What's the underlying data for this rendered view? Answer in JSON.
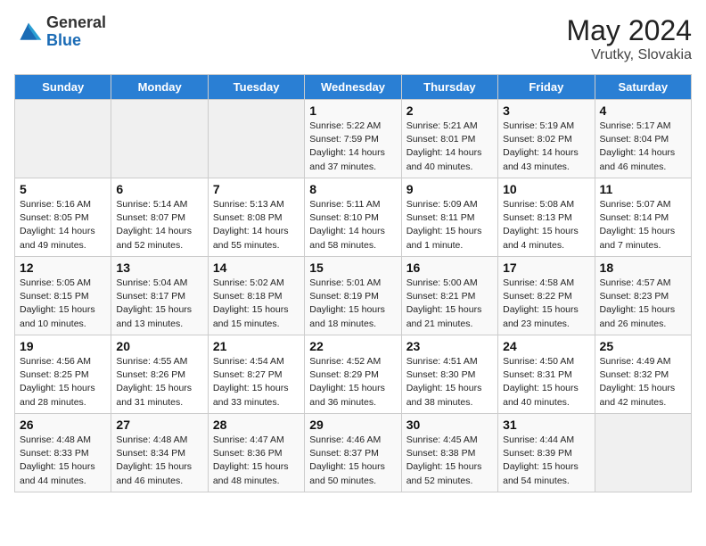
{
  "header": {
    "logo_general": "General",
    "logo_blue": "Blue",
    "month_year": "May 2024",
    "location": "Vrutky, Slovakia"
  },
  "weekdays": [
    "Sunday",
    "Monday",
    "Tuesday",
    "Wednesday",
    "Thursday",
    "Friday",
    "Saturday"
  ],
  "weeks": [
    [
      {
        "day": "",
        "info": ""
      },
      {
        "day": "",
        "info": ""
      },
      {
        "day": "",
        "info": ""
      },
      {
        "day": "1",
        "info": "Sunrise: 5:22 AM\nSunset: 7:59 PM\nDaylight: 14 hours and 37 minutes."
      },
      {
        "day": "2",
        "info": "Sunrise: 5:21 AM\nSunset: 8:01 PM\nDaylight: 14 hours and 40 minutes."
      },
      {
        "day": "3",
        "info": "Sunrise: 5:19 AM\nSunset: 8:02 PM\nDaylight: 14 hours and 43 minutes."
      },
      {
        "day": "4",
        "info": "Sunrise: 5:17 AM\nSunset: 8:04 PM\nDaylight: 14 hours and 46 minutes."
      }
    ],
    [
      {
        "day": "5",
        "info": "Sunrise: 5:16 AM\nSunset: 8:05 PM\nDaylight: 14 hours and 49 minutes."
      },
      {
        "day": "6",
        "info": "Sunrise: 5:14 AM\nSunset: 8:07 PM\nDaylight: 14 hours and 52 minutes."
      },
      {
        "day": "7",
        "info": "Sunrise: 5:13 AM\nSunset: 8:08 PM\nDaylight: 14 hours and 55 minutes."
      },
      {
        "day": "8",
        "info": "Sunrise: 5:11 AM\nSunset: 8:10 PM\nDaylight: 14 hours and 58 minutes."
      },
      {
        "day": "9",
        "info": "Sunrise: 5:09 AM\nSunset: 8:11 PM\nDaylight: 15 hours and 1 minute."
      },
      {
        "day": "10",
        "info": "Sunrise: 5:08 AM\nSunset: 8:13 PM\nDaylight: 15 hours and 4 minutes."
      },
      {
        "day": "11",
        "info": "Sunrise: 5:07 AM\nSunset: 8:14 PM\nDaylight: 15 hours and 7 minutes."
      }
    ],
    [
      {
        "day": "12",
        "info": "Sunrise: 5:05 AM\nSunset: 8:15 PM\nDaylight: 15 hours and 10 minutes."
      },
      {
        "day": "13",
        "info": "Sunrise: 5:04 AM\nSunset: 8:17 PM\nDaylight: 15 hours and 13 minutes."
      },
      {
        "day": "14",
        "info": "Sunrise: 5:02 AM\nSunset: 8:18 PM\nDaylight: 15 hours and 15 minutes."
      },
      {
        "day": "15",
        "info": "Sunrise: 5:01 AM\nSunset: 8:19 PM\nDaylight: 15 hours and 18 minutes."
      },
      {
        "day": "16",
        "info": "Sunrise: 5:00 AM\nSunset: 8:21 PM\nDaylight: 15 hours and 21 minutes."
      },
      {
        "day": "17",
        "info": "Sunrise: 4:58 AM\nSunset: 8:22 PM\nDaylight: 15 hours and 23 minutes."
      },
      {
        "day": "18",
        "info": "Sunrise: 4:57 AM\nSunset: 8:23 PM\nDaylight: 15 hours and 26 minutes."
      }
    ],
    [
      {
        "day": "19",
        "info": "Sunrise: 4:56 AM\nSunset: 8:25 PM\nDaylight: 15 hours and 28 minutes."
      },
      {
        "day": "20",
        "info": "Sunrise: 4:55 AM\nSunset: 8:26 PM\nDaylight: 15 hours and 31 minutes."
      },
      {
        "day": "21",
        "info": "Sunrise: 4:54 AM\nSunset: 8:27 PM\nDaylight: 15 hours and 33 minutes."
      },
      {
        "day": "22",
        "info": "Sunrise: 4:52 AM\nSunset: 8:29 PM\nDaylight: 15 hours and 36 minutes."
      },
      {
        "day": "23",
        "info": "Sunrise: 4:51 AM\nSunset: 8:30 PM\nDaylight: 15 hours and 38 minutes."
      },
      {
        "day": "24",
        "info": "Sunrise: 4:50 AM\nSunset: 8:31 PM\nDaylight: 15 hours and 40 minutes."
      },
      {
        "day": "25",
        "info": "Sunrise: 4:49 AM\nSunset: 8:32 PM\nDaylight: 15 hours and 42 minutes."
      }
    ],
    [
      {
        "day": "26",
        "info": "Sunrise: 4:48 AM\nSunset: 8:33 PM\nDaylight: 15 hours and 44 minutes."
      },
      {
        "day": "27",
        "info": "Sunrise: 4:48 AM\nSunset: 8:34 PM\nDaylight: 15 hours and 46 minutes."
      },
      {
        "day": "28",
        "info": "Sunrise: 4:47 AM\nSunset: 8:36 PM\nDaylight: 15 hours and 48 minutes."
      },
      {
        "day": "29",
        "info": "Sunrise: 4:46 AM\nSunset: 8:37 PM\nDaylight: 15 hours and 50 minutes."
      },
      {
        "day": "30",
        "info": "Sunrise: 4:45 AM\nSunset: 8:38 PM\nDaylight: 15 hours and 52 minutes."
      },
      {
        "day": "31",
        "info": "Sunrise: 4:44 AM\nSunset: 8:39 PM\nDaylight: 15 hours and 54 minutes."
      },
      {
        "day": "",
        "info": ""
      }
    ]
  ]
}
